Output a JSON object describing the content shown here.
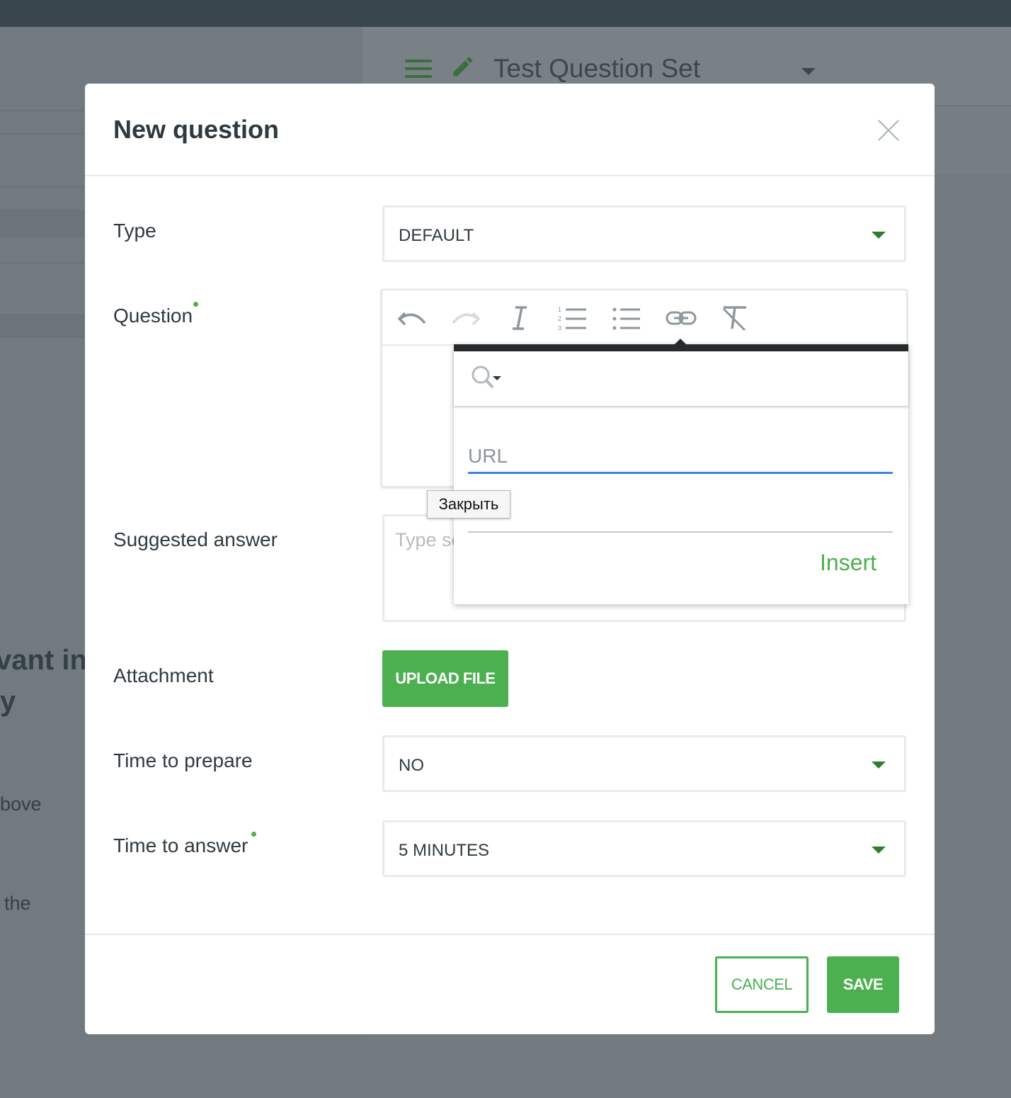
{
  "background": {
    "menu_icon": "hamburger-icon",
    "edit_icon": "pencil-icon",
    "set_title": "Test Question Set",
    "text_fragments": [
      "vant in",
      "y",
      "bove",
      "the"
    ]
  },
  "modal": {
    "title": "New question",
    "close_icon": "close-icon",
    "fields": {
      "type_label": "Type",
      "type_value": "DEFAULT",
      "question_label": "Question",
      "suggested_label": "Suggested answer",
      "suggested_placeholder": "Type sc",
      "attachment_label": "Attachment",
      "upload_label": "UPLOAD FILE",
      "prepare_label": "Time to prepare",
      "prepare_value": "NO",
      "answer_label": "Time to answer",
      "answer_value": "5 MINUTES"
    },
    "toolbar": [
      "undo-icon",
      "redo-icon",
      "italic-icon",
      "numbered-list-icon",
      "bullet-list-icon",
      "link-icon",
      "clear-format-icon"
    ],
    "footer": {
      "cancel_label": "CANCEL",
      "save_label": "SAVE"
    }
  },
  "link_popup": {
    "search_icon": "search-icon",
    "url_placeholder": "URL",
    "insert_label": "Insert"
  },
  "tooltip": {
    "text": "Закрыть"
  },
  "colors": {
    "accent": "#4caf50",
    "topbar": "#39454d",
    "overlay": "#737a80",
    "focus_line": "#3f82d8"
  }
}
